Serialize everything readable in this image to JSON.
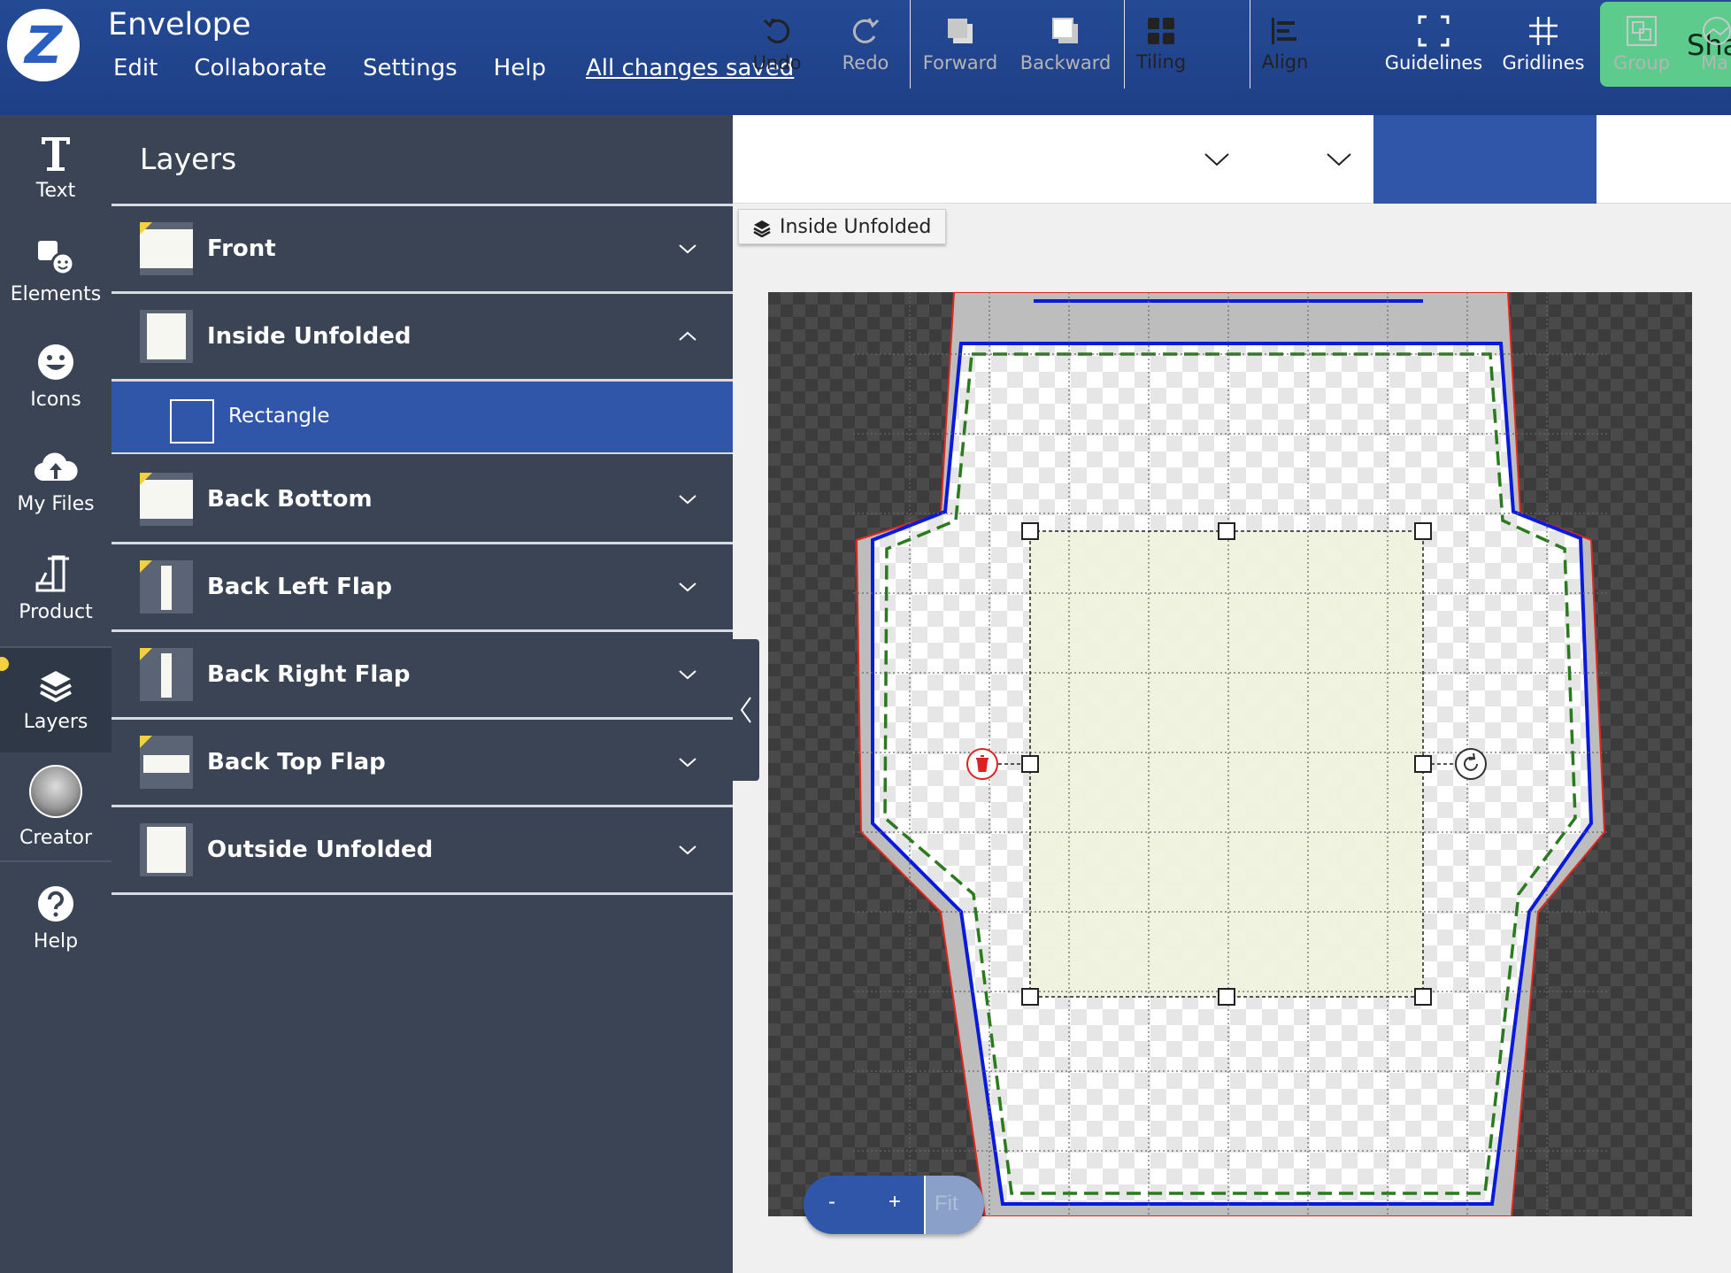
{
  "app": {
    "doc_title": "Envelope",
    "logo_letter": "Z",
    "menu": [
      "Edit",
      "Collaborate",
      "Settings",
      "Help"
    ],
    "save_status": "All changes saved",
    "share_label": "Sha"
  },
  "rail": {
    "items": [
      "Text",
      "Elements",
      "Icons",
      "My Files",
      "Product",
      "Layers",
      "Creator",
      "Help"
    ],
    "active": "Layers"
  },
  "panel": {
    "title": "Layers",
    "layers": [
      {
        "name": "Front",
        "expanded": false
      },
      {
        "name": "Inside Unfolded",
        "expanded": true,
        "children": [
          "Rectangle"
        ]
      },
      {
        "name": "Back Bottom",
        "expanded": false
      },
      {
        "name": "Back Left Flap",
        "expanded": false
      },
      {
        "name": "Back Right Flap",
        "expanded": false
      },
      {
        "name": "Back Top Flap",
        "expanded": false
      },
      {
        "name": "Outside Unfolded",
        "expanded": false
      }
    ]
  },
  "toolbar": {
    "undo": "Undo",
    "redo": "Redo",
    "forward": "Forward",
    "backward": "Backward",
    "tiling": "Tiling",
    "align": "Align",
    "guidelines": "Guidelines",
    "gridlines": "Gridlines",
    "group": "Group",
    "more": "Ma"
  },
  "active_layer_chip": "Inside Unfolded",
  "zoom": {
    "minus": "-",
    "plus": "+",
    "fit": "Fit"
  },
  "colors": {
    "header": "#244a94",
    "panel": "#3a4454",
    "selected": "#2f56a8",
    "share": "#5ccb8c",
    "safe_line": "#2a7a1e",
    "cut_line": "#0a1adc",
    "bleed_line": "#e0281e",
    "rect_fill": "#eef2dd"
  }
}
